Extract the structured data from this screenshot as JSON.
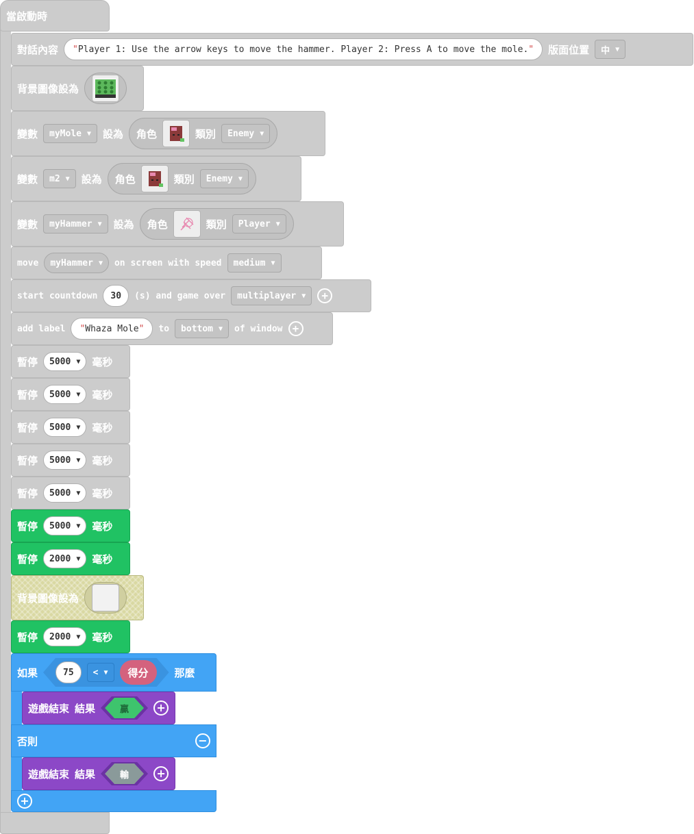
{
  "hat_label": "當啟動時",
  "dialog": {
    "label": "對話內容",
    "text": "Player 1: Use the arrow keys to move the hammer. Player 2: Press A to move the mole.",
    "position_label": "版面位置",
    "position_value": "中"
  },
  "background1": {
    "label": "背景圖像設為"
  },
  "var_mymole": {
    "label": "變數",
    "name": "myMole",
    "set_label": "設為",
    "sprite_label": "角色",
    "kind_label": "類別",
    "kind": "Enemy"
  },
  "var_m2": {
    "label": "變數",
    "name": "m2",
    "set_label": "設為",
    "sprite_label": "角色",
    "kind_label": "類別",
    "kind": "Enemy"
  },
  "var_hammer": {
    "label": "變數",
    "name": "myHammer",
    "set_label": "設為",
    "sprite_label": "角色",
    "kind_label": "類別",
    "kind": "Player"
  },
  "move": {
    "label": "move",
    "target": "myHammer",
    "mid": "on screen with speed",
    "speed": "medium"
  },
  "countdown": {
    "label": "start countdown",
    "seconds": "30",
    "mid": "(s) and game over",
    "mode": "multiplayer"
  },
  "label_block": {
    "label": "add label",
    "text": "Whaza Mole",
    "to": "to",
    "where": "bottom",
    "suffix": "of window"
  },
  "pauses": [
    {
      "label": "暫停",
      "ms": "5000",
      "unit": "毫秒",
      "style": "gray"
    },
    {
      "label": "暫停",
      "ms": "5000",
      "unit": "毫秒",
      "style": "gray"
    },
    {
      "label": "暫停",
      "ms": "5000",
      "unit": "毫秒",
      "style": "gray"
    },
    {
      "label": "暫停",
      "ms": "5000",
      "unit": "毫秒",
      "style": "gray"
    },
    {
      "label": "暫停",
      "ms": "5000",
      "unit": "毫秒",
      "style": "gray"
    },
    {
      "label": "暫停",
      "ms": "5000",
      "unit": "毫秒",
      "style": "green"
    },
    {
      "label": "暫停",
      "ms": "2000",
      "unit": "毫秒",
      "style": "green"
    }
  ],
  "background2": {
    "label": "背景圖像設為"
  },
  "pause_last": {
    "label": "暫停",
    "ms": "2000",
    "unit": "毫秒"
  },
  "if_block": {
    "if_label": "如果",
    "value": "75",
    "op": "<",
    "score": "得分",
    "then_label": "那麼",
    "else_label": "否則"
  },
  "gameover_win": {
    "label": "遊戲結束",
    "result_label": "結果",
    "result": "贏"
  },
  "gameover_lose": {
    "label": "遊戲結束",
    "result_label": "結果",
    "result": "輸"
  },
  "colors": {
    "gray_block": "#cccccc",
    "green_block": "#20c263",
    "blue_block": "#42a4f5",
    "purple_block": "#8c48c7",
    "score_pill": "#d4627e"
  },
  "icons": {
    "caret": "▼",
    "plus": "+",
    "minus": "−",
    "quote": "\""
  }
}
